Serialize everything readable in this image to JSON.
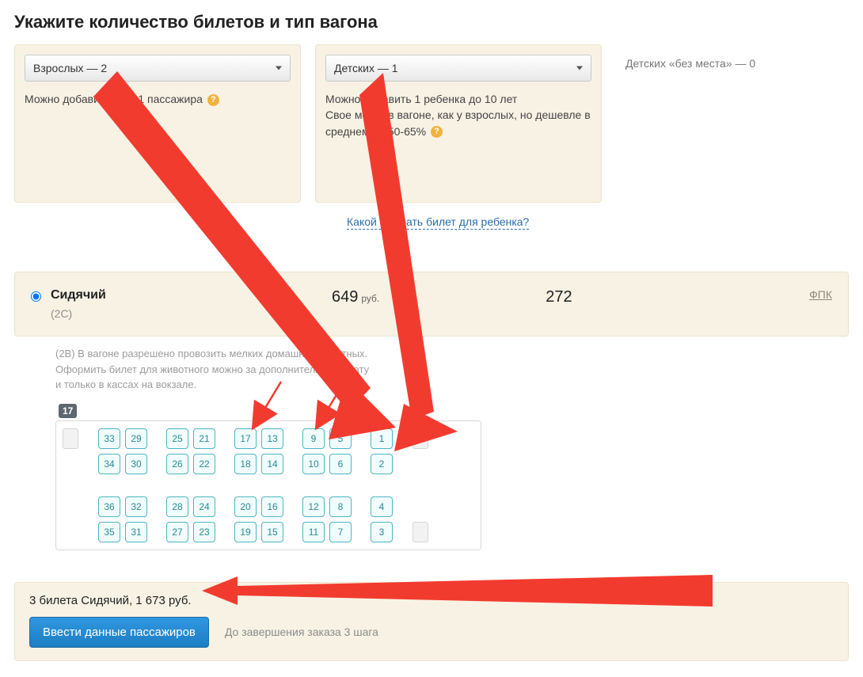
{
  "heading": "Укажите количество билетов и тип вагона",
  "selectors": {
    "adults": {
      "label": "Взрослых — 2",
      "hint_prefix": "Можно добавить еще 1 пассажира "
    },
    "children": {
      "label": "Детских — 1",
      "hint_lines": [
        "Можно добавить 1 ребенка до 10 лет",
        "Свое место в вагоне, как у взрослых, но дешевле в среднем на 50-65% "
      ]
    },
    "infants": {
      "label": "Детских «без места» — 0"
    }
  },
  "child_ticket_link": "Какой выбрать билет для ребенка?",
  "car_type": {
    "name": "Сидячий",
    "code": "(2С)",
    "price": "649",
    "currency": "руб.",
    "available": "272",
    "operator": "ФПК"
  },
  "car_info_lines": [
    "(2В) В вагоне разрешено провозить мелких домашних животных.",
    "Оформить билет для животного можно за дополнительную плату",
    "и только в кассах на вокзале."
  ],
  "carriage_number": "17",
  "seat_rows": {
    "row1": [
      "33",
      "29",
      "25",
      "21",
      "17",
      "13",
      "9",
      "5",
      "1"
    ],
    "row2": [
      "34",
      "30",
      "26",
      "22",
      "18",
      "14",
      "10",
      "6",
      "2"
    ],
    "row3": [
      "36",
      "32",
      "28",
      "24",
      "20",
      "16",
      "12",
      "8",
      "4"
    ],
    "row4": [
      "35",
      "31",
      "27",
      "23",
      "19",
      "15",
      "11",
      "7",
      "3"
    ]
  },
  "summary": {
    "line": "3 билета Сидячий, 1 673 руб.",
    "button": "Ввести данные пассажиров",
    "steps": "До завершения заказа 3 шага"
  }
}
